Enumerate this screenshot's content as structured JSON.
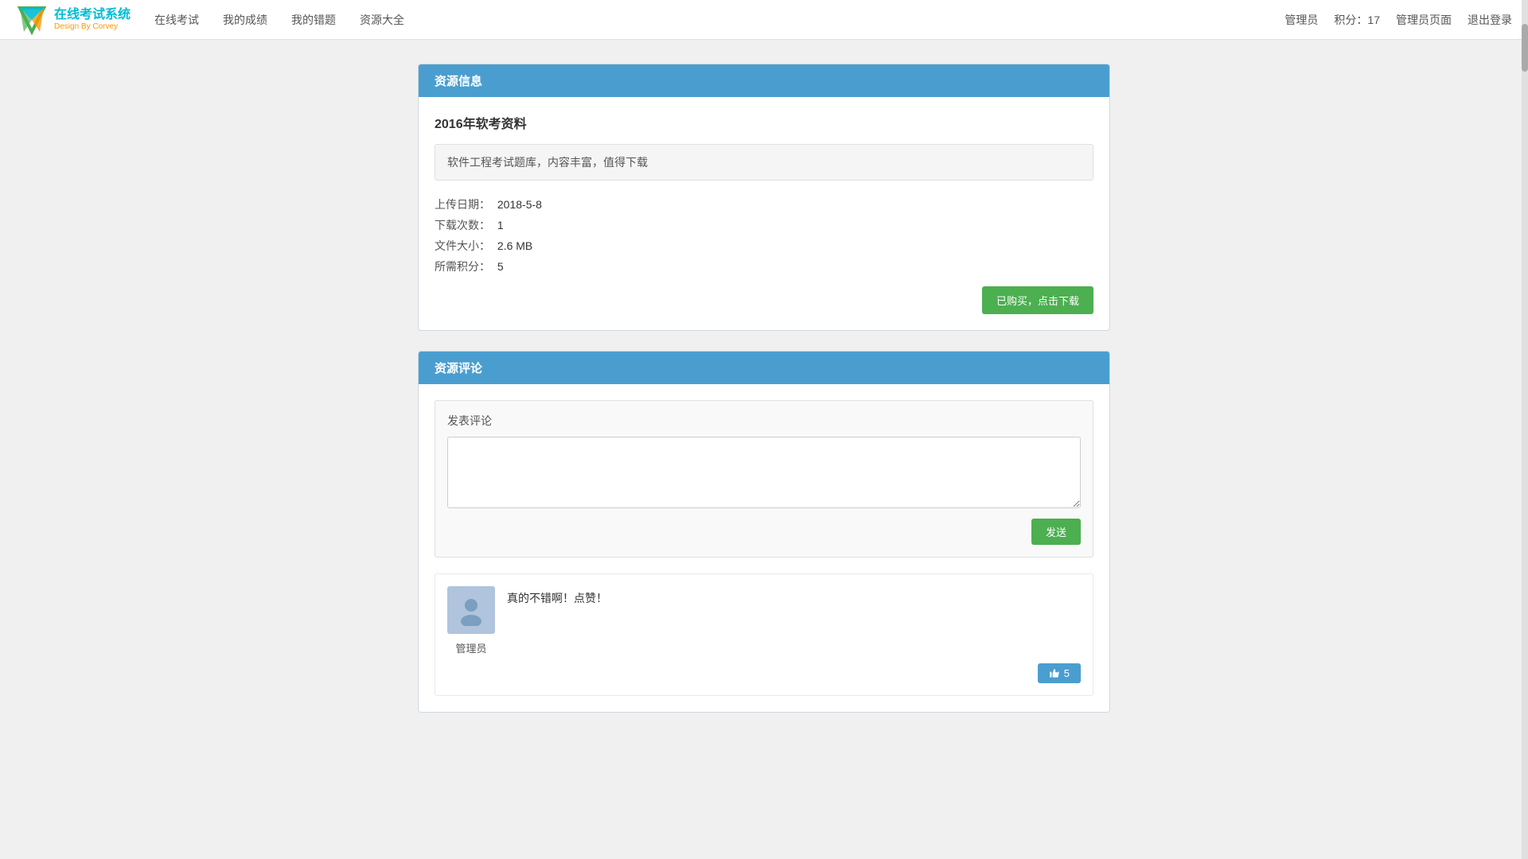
{
  "navbar": {
    "logo_title": "在线考试系统",
    "logo_subtitle": "Design By Corvey",
    "nav_items": [
      {
        "label": "在线考试",
        "id": "online-exam"
      },
      {
        "label": "我的成绩",
        "id": "my-scores"
      },
      {
        "label": "我的错题",
        "id": "my-mistakes"
      },
      {
        "label": "资源大全",
        "id": "resources"
      }
    ],
    "user_name": "管理员",
    "points_label": "积分：",
    "points_value": "17",
    "admin_page_label": "管理员页面",
    "logout_label": "退出登录"
  },
  "resource_info": {
    "section_title": "资源信息",
    "resource_title": "2016年软考资料",
    "resource_desc": "软件工程考试题库，内容丰富，值得下载",
    "upload_date_label": "上传日期：",
    "upload_date_value": "2018-5-8",
    "download_count_label": "下载次数：",
    "download_count_value": "1",
    "file_size_label": "文件大小：",
    "file_size_value": "2.6 MB",
    "points_needed_label": "所需积分：",
    "points_needed_value": "5",
    "download_btn": "已购买，点击下载"
  },
  "resource_comment": {
    "section_title": "资源评论",
    "post_comment_label": "发表评论",
    "textarea_placeholder": "",
    "send_btn": "发送",
    "comments": [
      {
        "username": "管理员",
        "text": "真的不错啊！点赞！",
        "likes": "5"
      }
    ]
  }
}
